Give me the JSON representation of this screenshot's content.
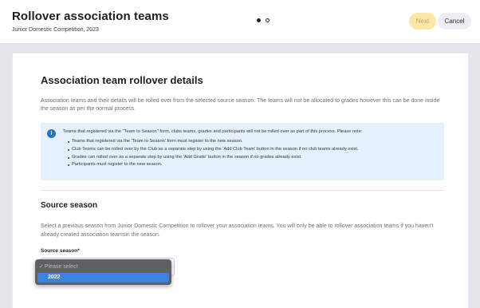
{
  "header": {
    "title": "Rollover association teams",
    "subtitle": "Junior Domestic Competition, 2023",
    "steps": {
      "total": 2,
      "current": 1
    },
    "next_label": "Next",
    "cancel_label": "Cancel"
  },
  "main": {
    "heading": "Association team rollover details",
    "description": "Association teams and their details will be rolled over from the selected source season. The teams will not be allocated to grades however this can be done inside the season as per the normal process.",
    "info": {
      "icon": "info-icon",
      "intro": "Teams that registered via the \"Team to Season\" form, clubs teams, grades and participants will not be rolled over as part of this process. Please note:",
      "items": [
        "Teams that registered via the 'Team to Season' form must register to the new season.",
        "Club Teams can be rolled over by the Club as a separate step by using the 'Add Club Team' button in the season if no club teams already exist.",
        "Grades can rolled over as a separate step by using the 'Add Grade' button in the season if no grades already exist.",
        "Participants must register to the new season."
      ]
    },
    "source": {
      "heading": "Source season",
      "description": "Select a previous season from Junior Domestic Competition to rollover your association teams. You will only be able to rollover association teams if you haven't already created association teamsin the season.",
      "field_label": "Source season*",
      "dropdown": {
        "placeholder": "Please select",
        "check_glyph": "✓",
        "options": [
          "2022"
        ],
        "highlighted": "2022"
      }
    }
  },
  "colors": {
    "next_bg": "#fbe7a6",
    "info_bg": "#e6f0fb",
    "info_icon": "#1f73d6",
    "dropdown_highlight": "#3b82e6"
  }
}
